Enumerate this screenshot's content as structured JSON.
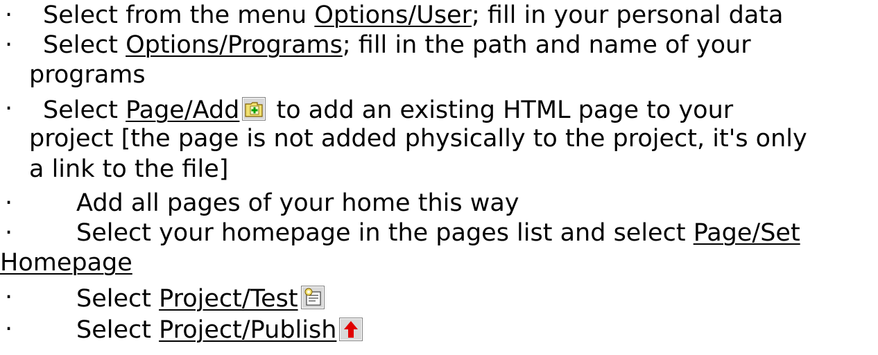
{
  "bullet_glyph": "·",
  "items": [
    {
      "pre": "Select from the menu ",
      "link": "Options/User",
      "post": "; fill in your personal data"
    },
    {
      "pre": "Select ",
      "link": "Options/Programs",
      "post": "; fill in the path and name of your",
      "cont": [
        "programs"
      ]
    },
    {
      "pre": "Select ",
      "link": "Page/Add",
      "icon": "add-page-folder-icon",
      "post": " to add an existing HTML page to your",
      "cont": [
        "project [the page is not added physically to the project, it's only",
        "a link to the file]"
      ]
    },
    {
      "text": "Add all pages of your home this way"
    },
    {
      "pre": "Select your homepage in the pages list and select ",
      "link": "Page/Set",
      "cont_link": "Homepage"
    },
    {
      "pre": "Select ",
      "link": "Project/Test",
      "icon": "test-project-icon"
    },
    {
      "pre": "Select ",
      "link": "Project/Publish",
      "icon": "publish-arrow-icon"
    }
  ],
  "colors": {
    "folder_yellow": "#f0e070",
    "plus_green": "#00a000",
    "arrow_red": "#e00000"
  }
}
